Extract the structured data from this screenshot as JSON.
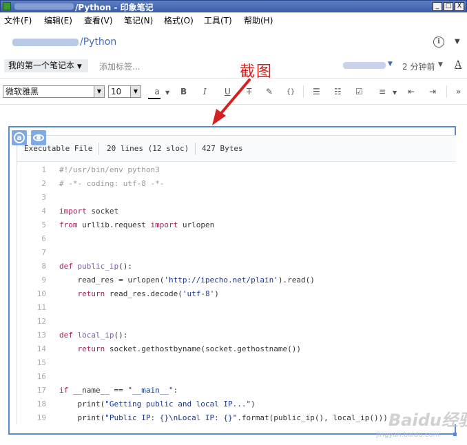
{
  "window": {
    "title": "/Python - 印象笔记",
    "minimize_glyph": "_",
    "maximize_glyph": "□",
    "close_glyph": "X"
  },
  "menu": [
    "文件(F)",
    "编辑(E)",
    "查看(V)",
    "笔记(N)",
    "格式(O)",
    "工具(T)",
    "帮助(H)"
  ],
  "breadcrumb": {
    "path": "/Python"
  },
  "notebook_row": {
    "notebook": "我的第一个笔记本",
    "tag_placeholder": "添加标签...",
    "modified": "2 分钟前"
  },
  "toolbar": {
    "font": "微软雅黑",
    "size": "10",
    "font_color_label": "a",
    "bold": "B",
    "italic": "I",
    "underline": "U",
    "strike": "T",
    "highlight": "✎",
    "code": "{}",
    "bulleted": "☰",
    "numbered": "☷",
    "checkbox": "☑",
    "align": "≡",
    "outdent": "⇤",
    "indent": "⇥",
    "more": "»"
  },
  "annotation": {
    "label": "截图",
    "color": "#d4201f"
  },
  "code_block": {
    "file_type": "Executable File",
    "lines_info": "20 lines (12 sloc)",
    "size_info": "427 Bytes",
    "lines": [
      "#!/usr/bin/env python3",
      "# -*- coding: utf-8 -*-",
      "",
      "import socket",
      "from urllib.request import urlopen",
      "",
      "",
      "def public_ip():",
      "    read_res = urlopen('http://ipecho.net/plain').read()",
      "    return read_res.decode('utf-8')",
      "",
      "",
      "def local_ip():",
      "    return socket.gethostbyname(socket.gethostname())",
      "",
      "",
      "if __name__ == \"__main__\":",
      "    print(\"Getting public and local IP...\")",
      "    print(\"Public IP: {}\\nLocal IP: {}\".format(public_ip(), local_ip()))"
    ]
  },
  "colors": {
    "accent": "#5b8ad6",
    "title_bar": "#3c5fa8",
    "link": "#3b6dbb"
  },
  "watermark": {
    "main": "Baidu经验",
    "sub": "jingyan.baidu.com"
  }
}
